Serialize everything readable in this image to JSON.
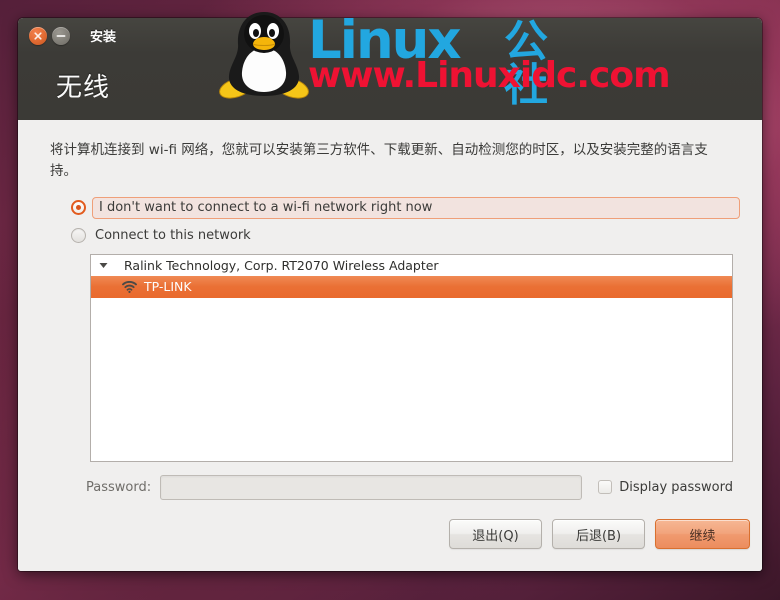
{
  "watermark": {
    "brand": "Linux",
    "brand_cn": "公社",
    "url": "www.Linuxidc.com",
    "penguin_icon": "linux-penguin-logo",
    "brand_color": "#22a7e0",
    "url_color": "#ef1233"
  },
  "window": {
    "title": "安装",
    "close_icon": "close-icon",
    "minimize_icon": "minimize-icon",
    "heading": "无线"
  },
  "content": {
    "intro": "将计算机连接到 wi-fi 网络，您就可以安装第三方软件、下载更新、自动检测您的时区，以及安装完整的语言支持。",
    "options": [
      {
        "label": "I don't want to connect to a wi-fi network right now",
        "selected": true
      },
      {
        "label": "Connect to this network",
        "selected": false
      }
    ],
    "network_list": {
      "expander_icon": "chevron-down-icon",
      "adapter": "Ralink Technology, Corp. RT2070 Wireless Adapter",
      "networks": [
        {
          "name": "TP-LINK",
          "icon": "wifi-icon",
          "selected": true
        }
      ]
    },
    "password": {
      "label": "Password:",
      "value": "",
      "placeholder": "",
      "display_password_label": "Display password",
      "display_password_checked": false
    }
  },
  "footer": {
    "quit_label": "退出(Q)",
    "back_label": "后退(B)",
    "continue_label": "继续",
    "accent_color": "#ec8d5e"
  }
}
